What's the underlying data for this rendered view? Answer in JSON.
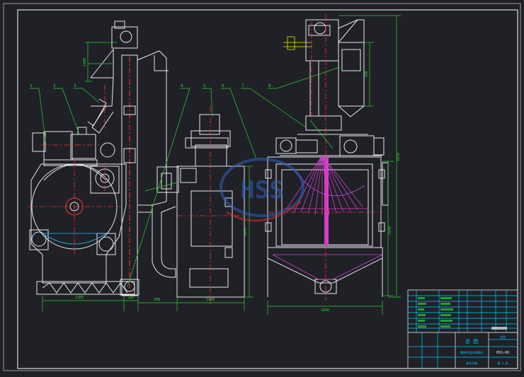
{
  "drawing": {
    "background": "#1f2127",
    "colors": {
      "frame": "#ffffff",
      "outline": "#e8e8e8",
      "dimension": "#2fd02f",
      "centerline": "#ff3030",
      "hidden": "#20c0ff",
      "shot": "#d040d0",
      "yellow": "#e8e800",
      "table": "#00c8ff",
      "watermark": "#3060c0"
    },
    "leader_labels": [
      "1",
      "2",
      "3",
      "4",
      "5",
      "6",
      "7",
      "8"
    ],
    "dimensions": {
      "left_total_width": "2385",
      "left_small_width": "280",
      "mid_offset": "600",
      "mid_width": "1400",
      "right_width": "1800",
      "right_inner_height": "2590",
      "right_total_height": "4850",
      "mid_height": "2070",
      "hopper_height": "1000",
      "upper_height": "500"
    },
    "watermark_text": "HSS",
    "title_block": {
      "title_cn": "总 图",
      "drawing_no": "HSS-00",
      "part_name": "履带式抛丸清理机",
      "scale_label": "比例",
      "sheet_label": "第 1 张",
      "company": "青岛华盛"
    }
  }
}
